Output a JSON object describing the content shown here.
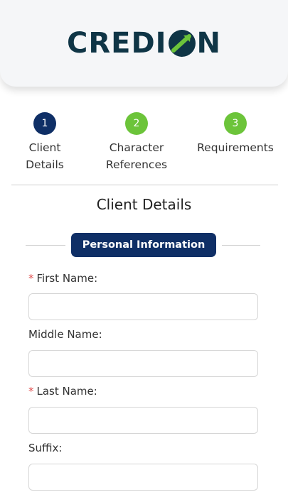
{
  "brand": {
    "logo_left": "CREDI",
    "logo_right": "N",
    "logo_icon": "o-with-arrow-icon",
    "colors": {
      "navy": "#0f3546",
      "green": "#6cc43a",
      "step_active": "#0f2f66"
    }
  },
  "steps": [
    {
      "number": "1",
      "label": "Client\nDetails",
      "state": "active"
    },
    {
      "number": "2",
      "label": "Character\nReferences",
      "state": "done"
    },
    {
      "number": "3",
      "label": "Requirements",
      "state": "done"
    }
  ],
  "section": {
    "title": "Client Details",
    "group": "Personal Information"
  },
  "form": {
    "first_name": {
      "label": "First Name:",
      "required": "*",
      "value": ""
    },
    "middle_name": {
      "label": "Middle Name:",
      "value": ""
    },
    "last_name": {
      "label": "Last Name:",
      "required": "*",
      "value": ""
    },
    "suffix": {
      "label": "Suffix:",
      "value": ""
    }
  }
}
